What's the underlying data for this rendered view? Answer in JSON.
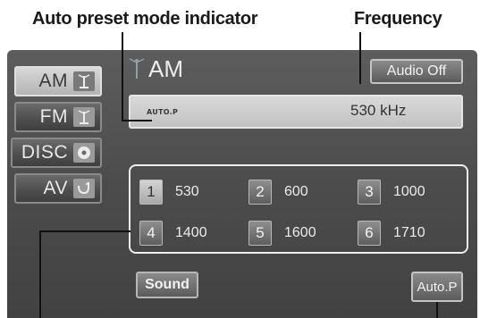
{
  "callouts": {
    "auto_preset_mode_indicator": "Auto preset mode indicator",
    "frequency": "Frequency"
  },
  "sources": [
    {
      "label": "AM",
      "icon": "antenna-icon",
      "active": true
    },
    {
      "label": "FM",
      "icon": "antenna-icon",
      "active": false
    },
    {
      "label": "DISC",
      "icon": "disc-icon",
      "active": false
    },
    {
      "label": "AV",
      "icon": "av-input-icon",
      "active": false
    }
  ],
  "header": {
    "title": "AM",
    "title_icon": "antenna-icon",
    "audio_off_label": "Audio Off"
  },
  "info_bar": {
    "auto_preset_indicator": "AUTO.P",
    "frequency": "530 kHz"
  },
  "presets": [
    {
      "number": "1",
      "frequency": "530",
      "selected": true
    },
    {
      "number": "2",
      "frequency": "600",
      "selected": false
    },
    {
      "number": "3",
      "frequency": "1000",
      "selected": false
    },
    {
      "number": "4",
      "frequency": "1400",
      "selected": false
    },
    {
      "number": "5",
      "frequency": "1600",
      "selected": false
    },
    {
      "number": "6",
      "frequency": "1710",
      "selected": false
    }
  ],
  "footer": {
    "sound_label": "Sound",
    "auto_p_label": "Auto.P"
  },
  "colors": {
    "screen_bg": "#4c4c4c",
    "active_button": "#c4c4c4",
    "text_light": "#ececec",
    "callout_text": "#1a1a1a"
  }
}
